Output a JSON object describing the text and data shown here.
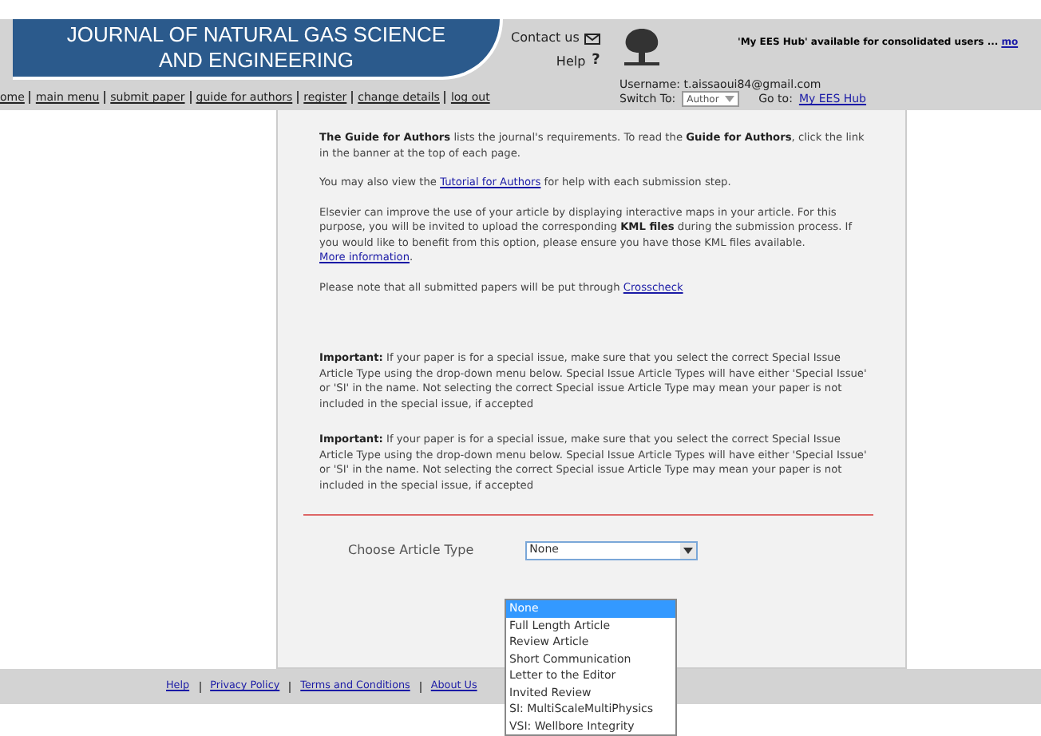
{
  "header": {
    "title_lines": [
      "JOURNAL OF NATURAL GAS SCIENCE",
      "AND ENGINEERING"
    ],
    "contact": "Contact us",
    "help": "Help",
    "help_icon": "?",
    "hub_notice": "'My EES Hub' available for consolidated users ...",
    "hub_more": "mo",
    "username_label": "Username:",
    "username": "t.aissaoui84@gmail.com",
    "switch_to": "Switch To:",
    "switch_value": "Author",
    "go_to": "Go to:",
    "hub_link": "My EES Hub"
  },
  "nav": [
    "ome",
    "main menu",
    "submit paper",
    "guide for authors",
    "register",
    "change details",
    "log out"
  ],
  "paragraphs": [
    [
      {
        "kind": "text",
        "text": "**The Guide for Authors** lists the journal's requirements. To read the **Guide for Authors**, click the link in the banner at the top of each page."
      }
    ],
    [
      {
        "kind": "text",
        "text": "You may also view the "
      },
      {
        "kind": "link",
        "text": "Tutorial for Authors"
      },
      {
        "kind": "text",
        "text": " for help with each submission step."
      }
    ],
    [
      {
        "kind": "text",
        "text": "Elsevier can improve the use of your article by displaying interactive maps in your article. For this purpose, you will be invited to upload the corresponding **KML files** during the submission process. If you would like to benefit from this option, please ensure you have those KML files available. "
      },
      {
        "kind": "link",
        "text": "More information"
      },
      {
        "kind": "text",
        "text": "."
      }
    ],
    [
      {
        "kind": "text",
        "text": "Please note that all submitted papers will be put through "
      },
      {
        "kind": "link",
        "text": "Crosscheck"
      }
    ]
  ],
  "notices": [
    "**Important:** If your paper is for a special issue, make sure that you select the correct Special Issue Article Type using the drop-down menu below. Special Issue Article Types will have either 'Special Issue' or 'SI' in the name. Not selecting the correct Special issue Article Type may mean your paper is not included in the special issue, if accepted",
    "**Important:** If your paper is for a special issue, make sure that you select the correct Special Issue Article Type using the drop-down menu below. Special Issue Article Types will have either 'Special Issue' or 'SI' in the name. Not selecting the correct Special issue Article Type may mean your paper is not included in the special issue, if accepted"
  ],
  "article_type": {
    "label": "Choose Article Type",
    "value": "None",
    "options": [
      {
        "label": "None",
        "selected": true
      },
      {
        "label": "Full Length Article",
        "selected": false
      },
      {
        "label": "Review Article",
        "selected": false
      },
      {
        "label": "Short Communication",
        "selected": false
      },
      {
        "label": "Letter to the Editor",
        "selected": false
      },
      {
        "label": "Invited Review",
        "selected": false
      },
      {
        "label": "SI: MultiScaleMultiPhysics",
        "selected": false
      },
      {
        "label": "VSI: Wellbore Integrity",
        "selected": false
      }
    ]
  },
  "footer": [
    "Help",
    "Privacy Policy",
    "Terms and Conditions",
    "About Us"
  ]
}
